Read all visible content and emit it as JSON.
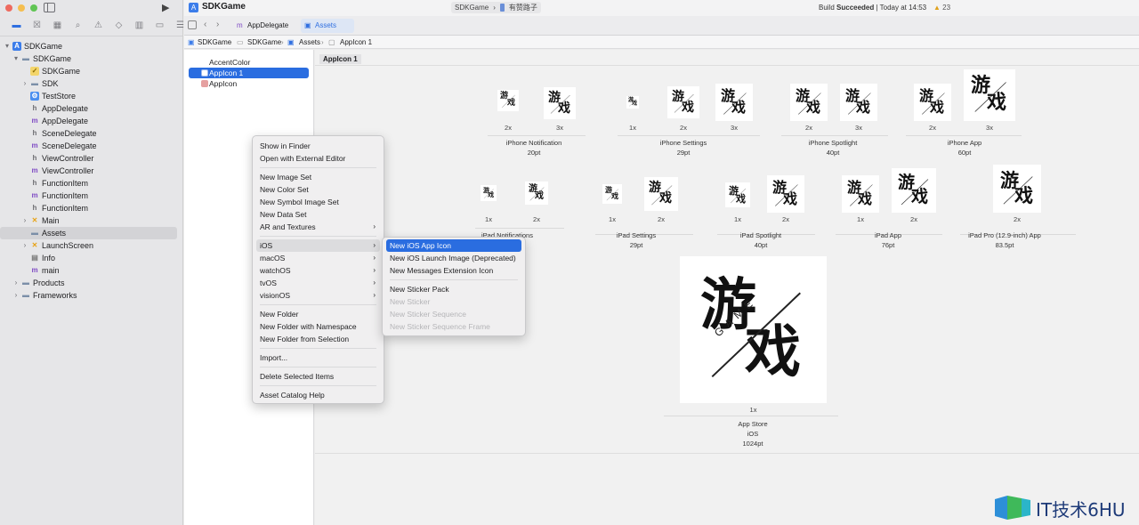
{
  "window": {
    "project_name": "SDKGame",
    "scheme_target": "SDKGame",
    "scheme_device": "有赞路子",
    "build_status_prefix": "Build ",
    "build_status_word": "Succeeded",
    "build_status_time": " | Today at 14:53",
    "warning_count": "23",
    "run_icon": "play-icon"
  },
  "colors": {
    "accent": "#2a6de0",
    "close": "#ee6a5f",
    "minimize": "#f5be4f",
    "zoom": "#61c554"
  },
  "nav_tabs": [
    "folder-icon",
    "source-control-icon",
    "symbol-icon",
    "find-icon",
    "issue-icon",
    "test-icon",
    "debug-icon",
    "breakpoint-icon",
    "report-icon"
  ],
  "tree": [
    {
      "label": "SDKGame",
      "depth": 0,
      "chev": "▾",
      "icon": "project"
    },
    {
      "label": "SDKGame",
      "depth": 1,
      "chev": "▾",
      "icon": "folder"
    },
    {
      "label": "SDKGame",
      "depth": 2,
      "chev": "",
      "icon": "entitlement"
    },
    {
      "label": "SDK",
      "depth": 2,
      "chev": "›",
      "icon": "folder"
    },
    {
      "label": "TestStore",
      "depth": 2,
      "chev": "",
      "icon": "store"
    },
    {
      "label": "AppDelegate",
      "depth": 2,
      "chev": "",
      "icon": "h"
    },
    {
      "label": "AppDelegate",
      "depth": 2,
      "chev": "",
      "icon": "m"
    },
    {
      "label": "SceneDelegate",
      "depth": 2,
      "chev": "",
      "icon": "h"
    },
    {
      "label": "SceneDelegate",
      "depth": 2,
      "chev": "",
      "icon": "m"
    },
    {
      "label": "ViewController",
      "depth": 2,
      "chev": "",
      "icon": "h"
    },
    {
      "label": "ViewController",
      "depth": 2,
      "chev": "",
      "icon": "m"
    },
    {
      "label": "FunctionItem",
      "depth": 2,
      "chev": "",
      "icon": "h"
    },
    {
      "label": "FunctionItem",
      "depth": 2,
      "chev": "",
      "icon": "m"
    },
    {
      "label": "FunctionItem",
      "depth": 2,
      "chev": "",
      "icon": "h"
    },
    {
      "label": "Main",
      "depth": 2,
      "chev": "›",
      "icon": "storyboard"
    },
    {
      "label": "Assets",
      "depth": 2,
      "chev": "",
      "icon": "folder",
      "selected": true
    },
    {
      "label": "LaunchScreen",
      "depth": 2,
      "chev": "›",
      "icon": "storyboard"
    },
    {
      "label": "Info",
      "depth": 2,
      "chev": "",
      "icon": "plist"
    },
    {
      "label": "main",
      "depth": 2,
      "chev": "",
      "icon": "m"
    },
    {
      "label": "Products",
      "depth": 1,
      "chev": "›",
      "icon": "folder"
    },
    {
      "label": "Frameworks",
      "depth": 1,
      "chev": "›",
      "icon": "folder"
    }
  ],
  "tabs": [
    {
      "label": "AppDelegate",
      "icon": "m"
    },
    {
      "label": "Assets",
      "icon": "assets"
    }
  ],
  "jumpbar": [
    "SDKGame",
    "SDKGame",
    "Assets",
    "AppIcon 1"
  ],
  "asset_list": [
    {
      "label": "AccentColor",
      "icon": "color"
    },
    {
      "label": "AppIcon 1",
      "icon": "appicon",
      "selected": true
    },
    {
      "label": "AppIcon",
      "icon": "appicon"
    }
  ],
  "editor": {
    "set_name": "AppIcon 1",
    "icon_glyph_top": "游",
    "icon_glyph_bottom": "戏",
    "icon_word": "GAME",
    "groups": [
      {
        "title": "iPhone Notification",
        "size": "20pt",
        "scales": [
          "2x",
          "3x"
        ]
      },
      {
        "title": "iPhone Settings",
        "size": "29pt",
        "scales": [
          "1x",
          "2x",
          "3x"
        ]
      },
      {
        "title": "iPhone Spotlight",
        "size": "40pt",
        "scales": [
          "2x",
          "3x"
        ]
      },
      {
        "title": "iPhone App",
        "size": "60pt",
        "scales": [
          "2x",
          "3x"
        ]
      },
      {
        "title": "iPad Notifications",
        "size": "",
        "scales": [
          "1x",
          "2x"
        ]
      },
      {
        "title": "iPad Settings",
        "size": "29pt",
        "scales": [
          "1x",
          "2x"
        ]
      },
      {
        "title": "iPad Spotlight",
        "size": "40pt",
        "scales": [
          "1x",
          "2x"
        ]
      },
      {
        "title": "iPad App",
        "size": "76pt",
        "scales": [
          "1x",
          "2x"
        ]
      },
      {
        "title": "iPad Pro (12.9-inch) App",
        "size": "83.5pt",
        "scales": [
          "2x"
        ]
      },
      {
        "title": "App Store",
        "subtitle": "iOS",
        "size": "1024pt",
        "scales": [
          "1x"
        ]
      }
    ]
  },
  "context_menu": {
    "items": [
      {
        "label": "Show in Finder"
      },
      {
        "label": "Open with External Editor"
      },
      {
        "sep": true
      },
      {
        "label": "New Image Set"
      },
      {
        "label": "New Color Set"
      },
      {
        "label": "New Symbol Image Set"
      },
      {
        "label": "New Data Set"
      },
      {
        "label": "AR and Textures",
        "submenu": true
      },
      {
        "sep": true
      },
      {
        "label": "iOS",
        "submenu": true,
        "hover": true
      },
      {
        "label": "macOS",
        "submenu": true
      },
      {
        "label": "watchOS",
        "submenu": true
      },
      {
        "label": "tvOS",
        "submenu": true
      },
      {
        "label": "visionOS",
        "submenu": true
      },
      {
        "sep": true
      },
      {
        "label": "New Folder"
      },
      {
        "label": "New Folder with Namespace"
      },
      {
        "label": "New Folder from Selection"
      },
      {
        "sep": true
      },
      {
        "label": "Import..."
      },
      {
        "sep": true
      },
      {
        "label": "Delete Selected Items"
      },
      {
        "sep": true
      },
      {
        "label": "Asset Catalog Help"
      }
    ]
  },
  "submenu": {
    "items": [
      {
        "label": "New iOS App Icon",
        "highlighted": true
      },
      {
        "label": "New iOS Launch Image (Deprecated)"
      },
      {
        "label": "New Messages Extension Icon"
      },
      {
        "sep": true
      },
      {
        "label": "New Sticker Pack"
      },
      {
        "label": "New Sticker",
        "disabled": true
      },
      {
        "label": "New Sticker Sequence",
        "disabled": true
      },
      {
        "label": "New Sticker Sequence Frame",
        "disabled": true
      }
    ]
  },
  "watermark": {
    "text": "IT技术6HU"
  }
}
